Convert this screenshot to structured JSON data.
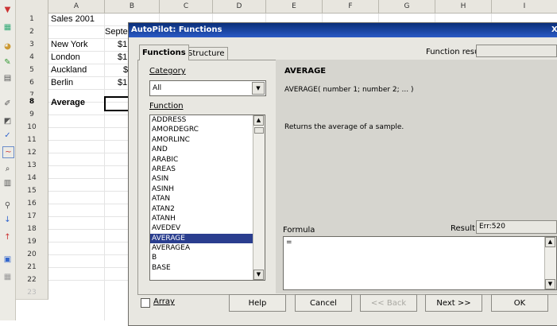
{
  "sheet": {
    "columns": [
      "A",
      "B",
      "C",
      "D",
      "E",
      "F",
      "G",
      "H",
      "I"
    ],
    "rows": [
      "1",
      "2",
      "3",
      "4",
      "5",
      "6",
      "7",
      "8",
      "9",
      "10",
      "11",
      "12",
      "13",
      "14",
      "15",
      "16",
      "17",
      "18",
      "19",
      "20",
      "21",
      "22",
      "23"
    ],
    "selected_row": "8",
    "cells": {
      "a1": "Sales 2001",
      "b2": "Septe",
      "a3": "New York",
      "b3": "$1,",
      "a4": "London",
      "b4": "$1,",
      "a5": "Auckland",
      "b5": "$",
      "a6": "Berlin",
      "b6": "$1,",
      "a8": "Average"
    }
  },
  "dialog": {
    "title": "AutoPilot: Functions",
    "close_glyph": "X",
    "tabs": [
      {
        "label": "Functions"
      },
      {
        "label": "Structure"
      }
    ],
    "function_result_label": "Function result",
    "category_label": "Category",
    "category_value": "All",
    "function_label": "Function",
    "functions": [
      "ADDRESS",
      "AMORDEGRC",
      "AMORLINC",
      "AND",
      "ARABIC",
      "AREAS",
      "ASIN",
      "ASINH",
      "ATAN",
      "ATAN2",
      "ATANH",
      "AVEDEV",
      "AVERAGE",
      "AVERAGEA",
      "B",
      "BASE"
    ],
    "selected_function": "AVERAGE",
    "function_name": "AVERAGE",
    "function_syntax": "AVERAGE( number 1; number 2; ... )",
    "function_description": "Returns the average of a sample.",
    "formula_label": "Formula",
    "formula_value": "=",
    "result_label": "Result",
    "result_value": "Err:520",
    "array_label": "Array",
    "buttons": {
      "help": "Help",
      "cancel": "Cancel",
      "back": "<< Back",
      "next": "Next >>",
      "ok": "OK"
    }
  },
  "colors": {
    "title_bar": "#0a2f7a",
    "selection": "#2a3e8f",
    "dialog_bg": "#e8e7e1"
  }
}
